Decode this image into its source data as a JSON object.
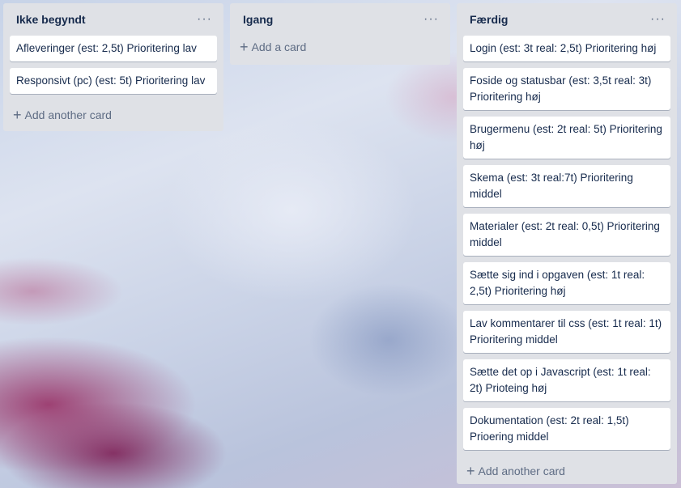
{
  "lists": [
    {
      "title": "Ikke begyndt",
      "menu": "···",
      "cards": [
        "Afleveringer (est: 2,5t) Prioritering lav",
        "Responsivt (pc) (est: 5t) Prioritering lav"
      ],
      "add_label": "Add another card"
    },
    {
      "title": "Igang",
      "menu": "···",
      "cards": [],
      "add_label": "Add a card"
    },
    {
      "title": "Færdig",
      "menu": "···",
      "cards": [
        "Login (est: 3t real: 2,5t) Prioritering høj",
        "Foside og statusbar (est: 3,5t real: 3t) Prioritering høj",
        "Brugermenu (est: 2t real: 5t) Prioritering høj",
        "Skema (est: 3t real:7t) Prioritering middel",
        "Materialer (est: 2t real: 0,5t) Prioritering middel",
        "Sætte sig ind i opgaven (est: 1t real: 2,5t) Prioritering høj",
        "Lav kommentarer til css (est: 1t real: 1t) Prioritering middel",
        "Sætte det op i Javascript (est: 1t real: 2t) Prioteing høj",
        "Dokumentation (est: 2t real: 1,5t) Prioering middel"
      ],
      "add_label": "Add another card"
    }
  ],
  "icons": {
    "plus": "+"
  }
}
